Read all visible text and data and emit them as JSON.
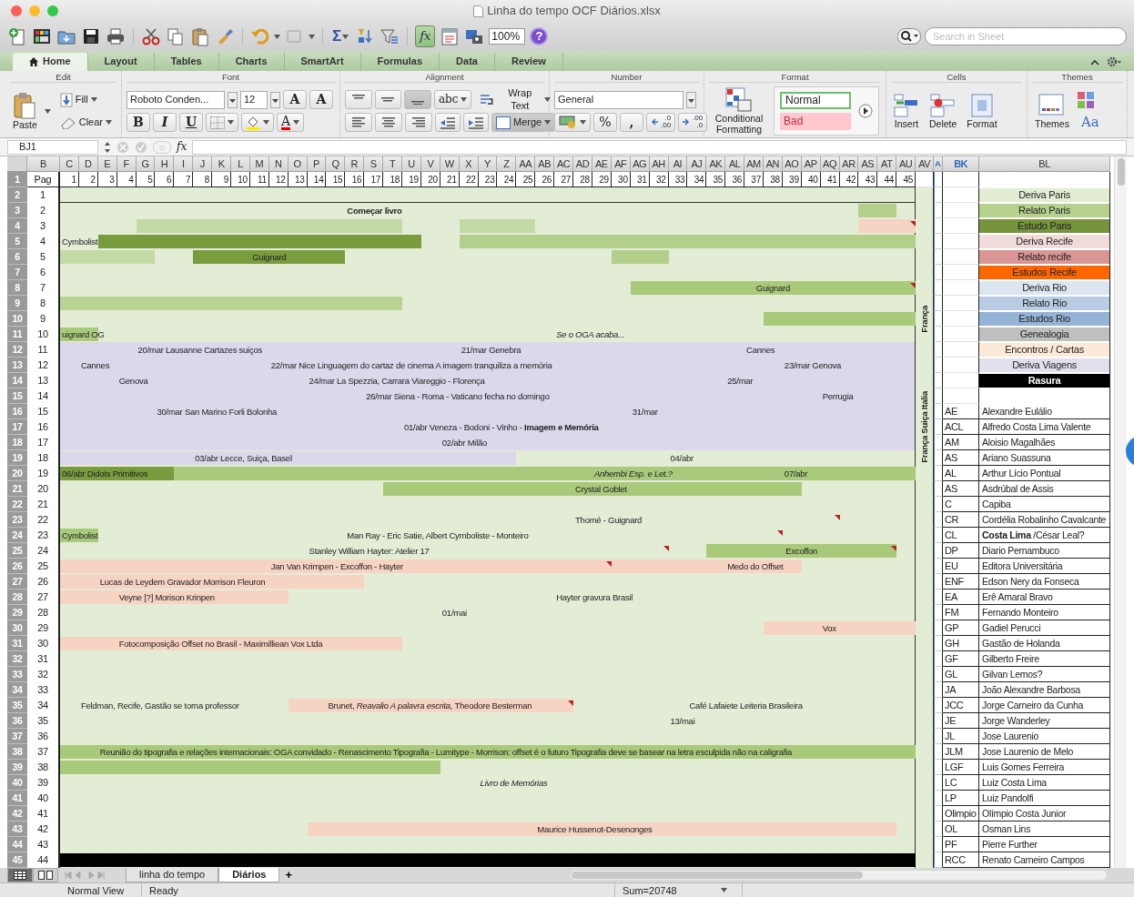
{
  "window": {
    "title": "Linha do tempo OCF Diários.xlsx"
  },
  "toolbar": {
    "autosum": "Σ",
    "formula_builder": {
      "label": "fx",
      "selected": true
    },
    "zoom": "100%",
    "help": "?",
    "search": {
      "placeholder": "Search in Sheet"
    }
  },
  "ribbon": {
    "tabs": [
      {
        "label": "Home",
        "selected": true
      },
      {
        "label": "Layout",
        "selected": false
      },
      {
        "label": "Tables",
        "selected": false
      },
      {
        "label": "Charts",
        "selected": false
      },
      {
        "label": "SmartArt",
        "selected": false
      },
      {
        "label": "Formulas",
        "selected": false
      },
      {
        "label": "Data",
        "selected": false
      },
      {
        "label": "Review",
        "selected": false
      }
    ],
    "groups": [
      "Edit",
      "Font",
      "Alignment",
      "Number",
      "Format",
      "Cells",
      "Themes"
    ],
    "paste": "Paste",
    "fill": "Fill",
    "clear": "Clear",
    "font_name": "Roboto Conden...",
    "font_size": "12",
    "grow": "A",
    "shrink": "A",
    "bold": "B",
    "italic": "I",
    "underline": "U",
    "font_color": "A",
    "abc": "abc",
    "wrap_text": "Wrap Text",
    "merge": "Merge",
    "number_format": "General",
    "percent": "%",
    "comma": ",",
    "decimals": [
      {
        "top": ".0",
        "bottom": ".00"
      },
      {
        "top": ".00",
        "bottom": ".0"
      }
    ],
    "conditional": "Conditional Formatting",
    "styles": [
      {
        "label": "Normal",
        "color": "#ffffff"
      },
      {
        "label": "Bad",
        "color": "#ffc7ce"
      }
    ],
    "insert": "Insert",
    "delete": "Delete",
    "format": "Format",
    "themes": "Themes",
    "theme_fonts": "Aa"
  },
  "formula_bar": {
    "name_box": "BJ1",
    "fx": "fx"
  },
  "sheet": {
    "columns": [
      {
        "letter": "B",
        "highlighted": false
      },
      {
        "letter": "C",
        "highlighted": false
      },
      {
        "letter": "D",
        "highlighted": false
      },
      {
        "letter": "E",
        "highlighted": false
      },
      {
        "letter": "F",
        "highlighted": false
      },
      {
        "letter": "G",
        "highlighted": false
      },
      {
        "letter": "H",
        "highlighted": false
      },
      {
        "letter": "I",
        "highlighted": false
      },
      {
        "letter": "J",
        "highlighted": false
      },
      {
        "letter": "K",
        "highlighted": false
      },
      {
        "letter": "L",
        "highlighted": false
      },
      {
        "letter": "M",
        "highlighted": false
      },
      {
        "letter": "N",
        "highlighted": false
      },
      {
        "letter": "O",
        "highlighted": false
      },
      {
        "letter": "P",
        "highlighted": false
      },
      {
        "letter": "Q",
        "highlighted": false
      },
      {
        "letter": "R",
        "highlighted": false
      },
      {
        "letter": "S",
        "highlighted": false
      },
      {
        "letter": "T",
        "highlighted": false
      },
      {
        "letter": "U",
        "highlighted": false
      },
      {
        "letter": "V",
        "highlighted": false
      },
      {
        "letter": "W",
        "highlighted": false
      },
      {
        "letter": "X",
        "highlighted": false
      },
      {
        "letter": "Y",
        "highlighted": false
      },
      {
        "letter": "Z",
        "highlighted": false
      },
      {
        "letter": "AA",
        "highlighted": false
      },
      {
        "letter": "AB",
        "highlighted": false
      },
      {
        "letter": "AC",
        "highlighted": false
      },
      {
        "letter": "AD",
        "highlighted": false
      },
      {
        "letter": "AE",
        "highlighted": false
      },
      {
        "letter": "AF",
        "highlighted": false
      },
      {
        "letter": "AG",
        "highlighted": false
      },
      {
        "letter": "AH",
        "highlighted": false
      },
      {
        "letter": "AI",
        "highlighted": false
      },
      {
        "letter": "AJ",
        "highlighted": false
      },
      {
        "letter": "AK",
        "highlighted": false
      },
      {
        "letter": "AL",
        "highlighted": false
      },
      {
        "letter": "AM",
        "highlighted": false
      },
      {
        "letter": "AN",
        "highlighted": false
      },
      {
        "letter": "AO",
        "highlighted": false
      },
      {
        "letter": "AP",
        "highlighted": false
      },
      {
        "letter": "AQ",
        "highlighted": false
      },
      {
        "letter": "AR",
        "highlighted": false
      },
      {
        "letter": "AS",
        "highlighted": false
      },
      {
        "letter": "AT",
        "highlighted": false
      },
      {
        "letter": "AU",
        "highlighted": false
      },
      {
        "letter": "AV",
        "highlighted": false
      },
      {
        "letter": "A",
        "highlighted": true
      },
      {
        "letter": "BK",
        "highlighted": true
      },
      {
        "letter": "BL",
        "highlighted": false
      }
    ],
    "side_labels": [
      {
        "text": "França"
      },
      {
        "text": "França Suiça Italia"
      }
    ],
    "rows": [
      {
        "kind": "header",
        "label": "1",
        "pag": "Pag",
        "numbers": [
          "1",
          "2",
          "3",
          "4",
          "5",
          "6",
          "7",
          "8",
          "9",
          "10",
          "11",
          "12",
          "13",
          "14",
          "15",
          "16",
          "17",
          "18",
          "19",
          "20",
          "21",
          "22",
          "23",
          "24",
          "25",
          "26",
          "27",
          "28",
          "29",
          "30",
          "31",
          "32",
          "33",
          "34",
          "35",
          "36",
          "37",
          "38",
          "39",
          "40",
          "41",
          "42",
          "43",
          "44",
          "45"
        ]
      },
      {
        "kind": "data",
        "label": "2",
        "pag": "1",
        "cells": [],
        "legend": {
          "text": "Deriva Paris",
          "color": "#e2edd4"
        }
      },
      {
        "kind": "data",
        "label": "3",
        "pag": "2",
        "cells": [
          {
            "kind": "label",
            "text": "Começar livro"
          },
          {
            "kind": "bar",
            "color": "#b4cf8c"
          }
        ],
        "legend": {
          "text": "Relato Paris",
          "color": "#b6d18d"
        }
      },
      {
        "kind": "data",
        "label": "4",
        "pag": "3",
        "cells": [
          {
            "kind": "bar",
            "color": "#c4daa4"
          },
          {
            "kind": "bar",
            "color": "#c4daa4"
          },
          {
            "kind": "bar",
            "color": "#f6d3c2"
          }
        ],
        "legend": {
          "text": "Estudo Paris",
          "color": "#76943c"
        }
      },
      {
        "kind": "data",
        "label": "5",
        "pag": "4",
        "cells": [
          {
            "kind": "label",
            "text": "Cymbolist"
          },
          {
            "kind": "bar",
            "color": "#799c3e"
          },
          {
            "kind": "bar",
            "color": "#b3cf8b"
          }
        ],
        "legend": {
          "text": "Deriva Recife",
          "color": "#f2dcdb"
        }
      },
      {
        "kind": "data",
        "label": "6",
        "pag": "5",
        "cells": [
          {
            "kind": "bar",
            "color": "#c4daa4"
          },
          {
            "kind": "bar",
            "color": "#799c3e",
            "text": "Guignard"
          },
          {
            "kind": "bar",
            "color": "#b3cf8b"
          }
        ],
        "legend": {
          "text": "Relato recife",
          "color": "#da9694"
        }
      },
      {
        "kind": "data",
        "label": "7",
        "pag": "6",
        "cells": [],
        "legend": {
          "text": "Estudos Recife",
          "color": "#ff6600"
        }
      },
      {
        "kind": "data",
        "label": "8",
        "pag": "7",
        "cells": [
          {
            "kind": "bar",
            "color": "#a9c97b",
            "text": "Guignard"
          }
        ],
        "legend": {
          "text": "Deriva Rio",
          "color": "#dce6f1"
        }
      },
      {
        "kind": "data",
        "label": "9",
        "pag": "8",
        "cells": [
          {
            "kind": "bar",
            "color": "#b9d394"
          }
        ],
        "legend": {
          "text": "Relato Rio",
          "color": "#b8cce4"
        }
      },
      {
        "kind": "data",
        "label": "10",
        "pag": "9",
        "cells": [
          {
            "kind": "bar",
            "color": "#a9c97b"
          }
        ],
        "legend": {
          "text": "Estudos Rio",
          "color": "#95b3d7"
        }
      },
      {
        "kind": "data",
        "label": "11",
        "pag": "10",
        "cells": [
          {
            "kind": "bar",
            "color": "#a9c97b",
            "text": "uignard OG"
          },
          {
            "kind": "label",
            "text": "Se o OGA acaba..."
          }
        ],
        "legend": {
          "text": "Genealogia",
          "color": "#bfbfbf"
        }
      },
      {
        "kind": "data",
        "label": "12",
        "pag": "11",
        "color": "#dcd7ea",
        "cells": [
          {
            "kind": "label",
            "text": "20/mar  Lausanne Cartazes suiços"
          },
          {
            "kind": "label",
            "text": "21/mar Genebra"
          },
          {
            "kind": "label",
            "text": "Cannes"
          }
        ],
        "legend": {
          "text": "Encontros / Cartas",
          "color": "#fde9d9"
        }
      },
      {
        "kind": "data",
        "label": "13",
        "pag": "12",
        "color": "#dcd7ea",
        "cells": [
          {
            "kind": "label",
            "text": "Cannes"
          },
          {
            "kind": "label",
            "text": "22/mar Nice Linguagem do cartaz de cinema A imagem tranquiliza a memória"
          },
          {
            "kind": "label",
            "text": "23/mar Genova"
          }
        ],
        "legend": {
          "text": "Deriva Viagens",
          "color": "#e4dfec"
        }
      },
      {
        "kind": "data",
        "label": "14",
        "pag": "13",
        "color": "#dcd7ea",
        "cells": [
          {
            "kind": "label",
            "text": "Genova"
          },
          {
            "kind": "label",
            "text": "24/mar La Spezzia, Carrara Viareggio  - Florença"
          },
          {
            "kind": "label",
            "text": "25/mar"
          }
        ],
        "legend": {
          "text": "Rasura",
          "color": "#000000"
        }
      },
      {
        "kind": "data",
        "label": "15",
        "pag": "14",
        "color": "#dcd7ea",
        "cells": [
          {
            "kind": "label",
            "text": "26/mar Siena - Roma - Vaticano fecha no domingo"
          },
          {
            "kind": "label",
            "text": "Perrugia"
          }
        ]
      },
      {
        "kind": "data",
        "label": "16",
        "pag": "15",
        "color": "#dcd7ea",
        "cells": [
          {
            "kind": "label",
            "text": "30/mar San Marino Forli Bolonha"
          },
          {
            "kind": "label",
            "text": "31/mar"
          }
        ],
        "person": {
          "code": "AE",
          "name": "Alexandre Eulálio"
        }
      },
      {
        "kind": "data",
        "label": "17",
        "pag": "16",
        "color": "#dcd7ea",
        "cells": [
          {
            "kind": "label",
            "text": "01/abr Veneza - Bodoni - Vinho - **Imagem e Memória**"
          }
        ],
        "person": {
          "code": "ACL",
          "name": "Alfredo Costa Lima Valente"
        }
      },
      {
        "kind": "data",
        "label": "18",
        "pag": "17",
        "color": "#dcd7ea",
        "cells": [
          {
            "kind": "label",
            "text": "02/abr Milão"
          }
        ],
        "person": {
          "code": "AM",
          "name": "Aloisio Magalhães"
        }
      },
      {
        "kind": "data",
        "label": "19",
        "pag": "18",
        "cells": [
          {
            "kind": "bar",
            "color": "#dcd7ea"
          },
          {
            "kind": "label",
            "text": "03/abr  Lecce, Suiça, Basel"
          },
          {
            "kind": "label",
            "text": "04/abr"
          }
        ],
        "person": {
          "code": "AS",
          "name": "Ariano Suassuna"
        }
      },
      {
        "kind": "data",
        "label": "20",
        "pag": "19",
        "cells": [
          {
            "kind": "bar",
            "color": "#799c3e",
            "text": "06/abr Didots Primitivos"
          },
          {
            "kind": "bar",
            "color": "#a9c97b"
          },
          {
            "kind": "label",
            "text": "Anhembi Esp. e Let.?"
          },
          {
            "kind": "label",
            "text": "07/abr"
          }
        ],
        "person": {
          "code": "AL",
          "name": "Arthur Lício Pontual"
        }
      },
      {
        "kind": "data",
        "label": "21",
        "pag": "20",
        "cells": [
          {
            "kind": "bar",
            "color": "#a9c97b"
          },
          {
            "kind": "label",
            "text": "Crystal Goblet"
          }
        ],
        "person": {
          "code": "AS",
          "name": "Asdrúbal de Assis"
        }
      },
      {
        "kind": "data",
        "label": "22",
        "pag": "21",
        "cells": [],
        "person": {
          "code": "C",
          "name": "Capiba"
        }
      },
      {
        "kind": "data",
        "label": "23",
        "pag": "22",
        "cells": [
          {
            "kind": "label",
            "text": "Thomé - Guignard"
          }
        ],
        "person": {
          "code": "CR",
          "name": "Cordélia Robalinho Cavalcante"
        }
      },
      {
        "kind": "data",
        "label": "24",
        "pag": "23",
        "cells": [
          {
            "kind": "bar",
            "color": "#a9c97b",
            "text": "Cymbolist"
          },
          {
            "kind": "label",
            "text": "Man Ray - Eric Satie, Albert Cymboliste - Monteiro"
          }
        ],
        "person": {
          "code": "CL",
          "name": "**Costa Lima** /César Leal?"
        }
      },
      {
        "kind": "data",
        "label": "25",
        "pag": "24",
        "cells": [
          {
            "kind": "label",
            "text": "Stanley  William Hayter:  Atelier 17"
          },
          {
            "kind": "bar",
            "color": "#a9c97b",
            "text": "Excoffon"
          }
        ],
        "person": {
          "code": "DP",
          "name": "Diario Pernambuco"
        }
      },
      {
        "kind": "data",
        "label": "26",
        "pag": "25",
        "cells": [
          {
            "kind": "bar",
            "color": "#f6d3c2"
          },
          {
            "kind": "label",
            "text": "Jan Van Krimpen  - Excoffon  - Hayter"
          },
          {
            "kind": "label",
            "text": "Medo do Offset"
          }
        ],
        "person": {
          "code": "EU",
          "name": "Editora Universitária"
        }
      },
      {
        "kind": "data",
        "label": "27",
        "pag": "26",
        "cells": [
          {
            "kind": "bar",
            "color": "#f6d3c2"
          },
          {
            "kind": "label",
            "text": "Lucas de Leydem Gravador Morrison Fleuron"
          }
        ],
        "person": {
          "code": "ENF",
          "name": "Edson Nery da Fonseca"
        }
      },
      {
        "kind": "data",
        "label": "28",
        "pag": "27",
        "cells": [
          {
            "kind": "bar",
            "color": "#f6d3c2"
          },
          {
            "kind": "label",
            "text": "Veyne [?] Morison Krinpen"
          },
          {
            "kind": "label",
            "text": "Hayter gravura Brasil"
          }
        ],
        "person": {
          "code": "EA",
          "name": "Erê Amaral Bravo"
        }
      },
      {
        "kind": "data",
        "label": "29",
        "pag": "28",
        "cells": [
          {
            "kind": "label",
            "text": "01/mai"
          }
        ],
        "person": {
          "code": "FM",
          "name": "Fernando Monteiro"
        }
      },
      {
        "kind": "data",
        "label": "30",
        "pag": "29",
        "cells": [
          {
            "kind": "bar",
            "color": "#f6d3c2"
          },
          {
            "kind": "label",
            "text": "Vox"
          }
        ],
        "person": {
          "code": "GP",
          "name": "Gadiel Perucci"
        }
      },
      {
        "kind": "data",
        "label": "31",
        "pag": "30",
        "cells": [
          {
            "kind": "bar",
            "color": "#f6d3c2"
          },
          {
            "kind": "label",
            "text": "Fotocomposição Offset no Brasil - Maximilliean Vox Ltda"
          }
        ],
        "person": {
          "code": "GH",
          "name": "Gastão de Holanda"
        }
      },
      {
        "kind": "data",
        "label": "32",
        "pag": "31",
        "cells": [],
        "person": {
          "code": "GF",
          "name": "Gilberto Freire"
        }
      },
      {
        "kind": "data",
        "label": "33",
        "pag": "32",
        "cells": [],
        "person": {
          "code": "GL",
          "name": "Gilvan Lemos?"
        }
      },
      {
        "kind": "data",
        "label": "34",
        "pag": "33",
        "cells": [],
        "person": {
          "code": "JA",
          "name": "João Alexandre Barbosa"
        }
      },
      {
        "kind": "data",
        "label": "35",
        "pag": "34",
        "cells": [
          {
            "kind": "label",
            "text": "Feldman, Recife, Gastão se torna professor"
          },
          {
            "kind": "bar",
            "color": "#f6d3c2"
          },
          {
            "kind": "label",
            "text": "Brunet, *Reavalio  A palavra escrita,* Theodore Besterman"
          },
          {
            "kind": "label",
            "text": "Café Lafaiete Leiteria Brasileira"
          }
        ],
        "person": {
          "code": "JCC",
          "name": "Jorge Carneiro da Cunha"
        }
      },
      {
        "kind": "data",
        "label": "36",
        "pag": "35",
        "cells": [
          {
            "kind": "label",
            "text": "13/mai"
          }
        ],
        "person": {
          "code": "JE",
          "name": "Jorge Wanderley"
        }
      },
      {
        "kind": "data",
        "label": "37",
        "pag": "36",
        "cells": [],
        "person": {
          "code": "JL",
          "name": "Jose Laurenio"
        }
      },
      {
        "kind": "data",
        "label": "38",
        "pag": "37",
        "cells": [
          {
            "kind": "bar",
            "color": "#a9c97b"
          },
          {
            "kind": "label",
            "text": "Reunião do tipografia e relações internacionais: OGA convidado  - Renascimento Tipografia  - Lumitype  - Morrison: offset é o futuro Tipografia deve se basear na letra esculpida não na caligrafia"
          }
        ],
        "person": {
          "code": "JLM",
          "name": "Jose Laurenio de Melo"
        }
      },
      {
        "kind": "data",
        "label": "39",
        "pag": "38",
        "cells": [
          {
            "kind": "bar",
            "color": "#a9c97b"
          }
        ],
        "person": {
          "code": "LGF",
          "name": "Luis Gomes Ferreira"
        }
      },
      {
        "kind": "data",
        "label": "40",
        "pag": "39",
        "cells": [
          {
            "kind": "label",
            "text": "Livro de Memórias"
          }
        ],
        "person": {
          "code": "LC",
          "name": "Luiz Costa Lima"
        }
      },
      {
        "kind": "data",
        "label": "41",
        "pag": "40",
        "cells": [],
        "person": {
          "code": "LP",
          "name": "Luiz Pandolfi"
        }
      },
      {
        "kind": "data",
        "label": "42",
        "pag": "41",
        "cells": [],
        "person": {
          "code": "Olimpio",
          "name": "Olímpio Costa Junior"
        }
      },
      {
        "kind": "data",
        "label": "43",
        "pag": "42",
        "cells": [
          {
            "kind": "bar",
            "color": "#f6d3c2"
          },
          {
            "kind": "label",
            "text": "Maurice Hussenot-Desenonges"
          }
        ],
        "person": {
          "code": "OL",
          "name": "Osman Lins"
        }
      },
      {
        "kind": "data",
        "label": "44",
        "pag": "43",
        "cells": [],
        "person": {
          "code": "PF",
          "name": "Pierre Further"
        }
      },
      {
        "kind": "data",
        "label": "45",
        "pag": "44",
        "cells": [
          {
            "kind": "bar",
            "color": "#000000"
          }
        ],
        "person": {
          "code": "RCC",
          "name": "Renato Carneiro Campos"
        }
      }
    ]
  },
  "sheet_tabs": [
    {
      "label": "linha do tempo",
      "selected": false
    },
    {
      "label": "Diários",
      "selected": true
    }
  ],
  "add_sheet": "+",
  "status_bar": {
    "view": "Normal View",
    "state": "Ready",
    "sum": "Sum=20748"
  }
}
